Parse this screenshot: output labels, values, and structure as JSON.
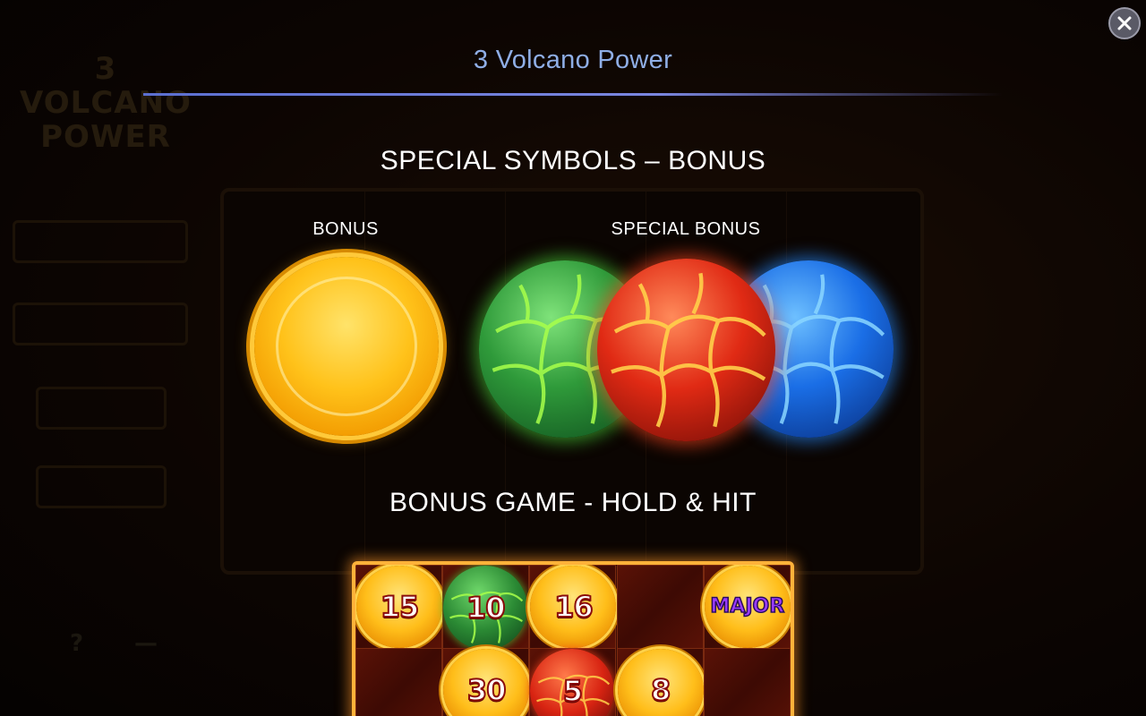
{
  "window": {
    "title": "3 Volcano Power",
    "close_icon": "close-icon"
  },
  "special_symbols": {
    "heading": "SPECIAL SYMBOLS – BONUS",
    "bonus_label": "BONUS",
    "special_bonus_label": "SPECIAL BONUS",
    "bonus_symbol": "gold-coin",
    "special_bonus_symbols": [
      "green-orb",
      "red-orb",
      "blue-orb"
    ]
  },
  "bonus_game": {
    "heading": "BONUS GAME - HOLD & HIT",
    "grid": [
      [
        {
          "kind": "coin",
          "value": "15"
        },
        {
          "kind": "green-orb",
          "value": "10"
        },
        {
          "kind": "coin",
          "value": "16"
        },
        {
          "kind": "empty",
          "value": ""
        },
        {
          "kind": "coin",
          "value": "MAJOR"
        }
      ],
      [
        {
          "kind": "empty",
          "value": ""
        },
        {
          "kind": "coin",
          "value": "30"
        },
        {
          "kind": "red-orb",
          "value": "5"
        },
        {
          "kind": "coin",
          "value": "8"
        },
        {
          "kind": "empty",
          "value": ""
        }
      ]
    ]
  },
  "colors": {
    "title": "#8faee6",
    "rule": "#6a7ad8",
    "frame": "#ffb23a",
    "green": "#2f9a3a",
    "red": "#e02a14",
    "blue": "#1a6ee6",
    "gold": "#ffc21a"
  }
}
